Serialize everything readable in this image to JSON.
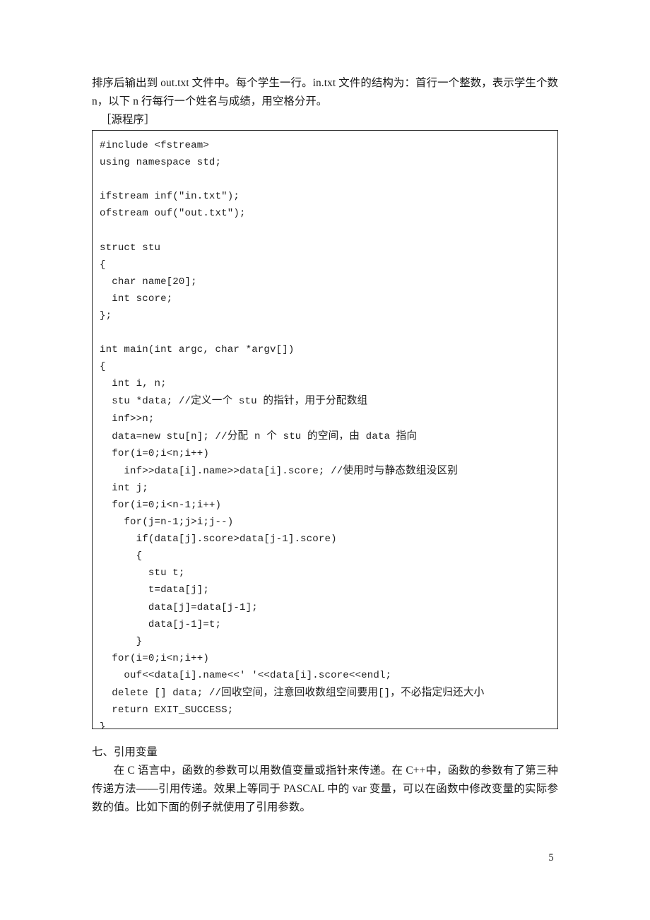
{
  "document": {
    "page_number": "5",
    "intro_paragraph": "排序后输出到 out.txt 文件中。每个学生一行。in.txt 文件的结构为：首行一个整数，表示学生个数 n，以下 n 行每行一个姓名与成绩，用空格分开。",
    "source_label": "［源程序］",
    "code_lines": [
      "#include <fstream>",
      "using namespace std;",
      "",
      "ifstream inf(\"in.txt\");",
      "ofstream ouf(\"out.txt\");",
      "",
      "struct stu",
      "{",
      "  char name[20];",
      "  int score;",
      "};",
      "",
      "int main(int argc, char *argv[])",
      "{",
      "  int i, n;",
      "  stu *data; //定义一个 stu 的指针，用于分配数组",
      "  inf>>n;",
      "  data=new stu[n]; //分配 n 个 stu 的空间，由 data 指向",
      "  for(i=0;i<n;i++)",
      "    inf>>data[i].name>>data[i].score; //使用时与静态数组没区别",
      "  int j;",
      "  for(i=0;i<n-1;i++)",
      "    for(j=n-1;j>i;j--)",
      "      if(data[j].score>data[j-1].score)",
      "      {",
      "        stu t;",
      "        t=data[j];",
      "        data[j]=data[j-1];",
      "        data[j-1]=t;",
      "      }",
      "  for(i=0;i<n;i++)",
      "    ouf<<data[i].name<<' '<<data[i].score<<endl;",
      "  delete [] data; //回收空间，注意回收数组空间要用[]，不必指定归还大小",
      "  return EXIT_SUCCESS;",
      "}"
    ],
    "section_heading": "七、引用变量",
    "section_paragraph": "在 C 语言中，函数的参数可以用数值变量或指针来传递。在 C++中，函数的参数有了第三种传递方法——引用传递。效果上等同于 PASCAL 中的 var 变量，可以在函数中修改变量的实际参数的值。比如下面的例子就使用了引用参数。"
  }
}
